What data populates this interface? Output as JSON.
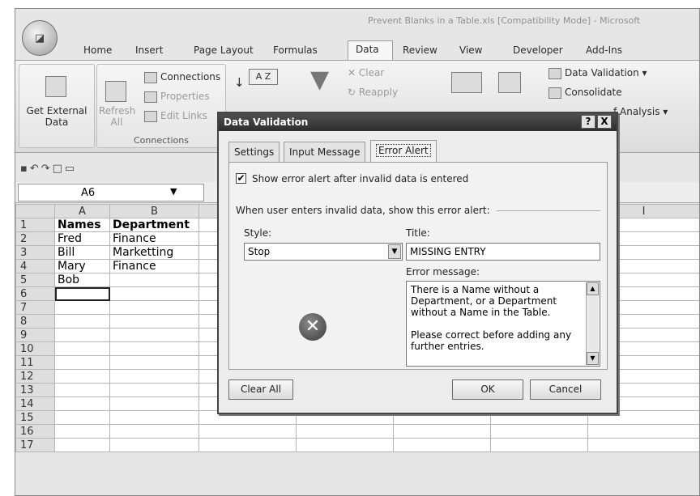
{
  "window": {
    "title": "Prevent Blanks in a Table.xls  [Compatibility Mode] - Microsoft"
  },
  "office_button": {
    "label": "Office"
  },
  "ribbon_tabs": [
    "Home",
    "Insert",
    "Page Layout",
    "Formulas",
    "Data",
    "Review",
    "View",
    "Developer",
    "Add-Ins"
  ],
  "active_tab": "Data",
  "ribbon": {
    "get_external_data": "Get External Data",
    "refresh_all": "Refresh All",
    "connections": "Connections",
    "properties": "Properties",
    "edit_links": "Edit Links",
    "connections_group": "Connections",
    "sort_az": "A Z",
    "clear": "Clear",
    "reapply": "Reapply",
    "data_validation": "Data Validation",
    "consolidate": "Consolidate",
    "what_if": "f Analysis"
  },
  "name_box": {
    "value": "A6"
  },
  "sheet": {
    "columns": [
      "A",
      "B"
    ],
    "extra_column": "I",
    "rows": [
      {
        "n": "1",
        "a": "Names",
        "b": "Department"
      },
      {
        "n": "2",
        "a": "Fred",
        "b": "Finance"
      },
      {
        "n": "3",
        "a": "Bill",
        "b": "Marketting"
      },
      {
        "n": "4",
        "a": "Mary",
        "b": "Finance"
      },
      {
        "n": "5",
        "a": "Bob",
        "b": ""
      },
      {
        "n": "6",
        "a": "",
        "b": ""
      },
      {
        "n": "7",
        "a": "",
        "b": ""
      },
      {
        "n": "8",
        "a": "",
        "b": ""
      },
      {
        "n": "9",
        "a": "",
        "b": ""
      },
      {
        "n": "10",
        "a": "",
        "b": ""
      },
      {
        "n": "11",
        "a": "",
        "b": ""
      },
      {
        "n": "12",
        "a": "",
        "b": ""
      },
      {
        "n": "13",
        "a": "",
        "b": ""
      },
      {
        "n": "14",
        "a": "",
        "b": ""
      },
      {
        "n": "15",
        "a": "",
        "b": ""
      },
      {
        "n": "16",
        "a": "",
        "b": ""
      },
      {
        "n": "17",
        "a": "",
        "b": ""
      }
    ]
  },
  "dialog": {
    "title": "Data Validation",
    "help": "?",
    "close": "X",
    "tabs": [
      "Settings",
      "Input Message",
      "Error Alert"
    ],
    "active_tab": "Error Alert",
    "show_alert_label": "Show error alert after invalid data is entered",
    "show_alert_checked": true,
    "when_invalid": "When user enters invalid data, show this error alert:",
    "style_label": "Style:",
    "style_value": "Stop",
    "title_label": "Title:",
    "title_value": "MISSING ENTRY",
    "error_message_label": "Error message:",
    "error_message": "There is a Name without a\nDepartment, or a Department\nwithout a Name in the Table.\n\nPlease correct before adding any\nfurther entries.",
    "clear_all": "Clear All",
    "ok": "OK",
    "cancel": "Cancel"
  }
}
